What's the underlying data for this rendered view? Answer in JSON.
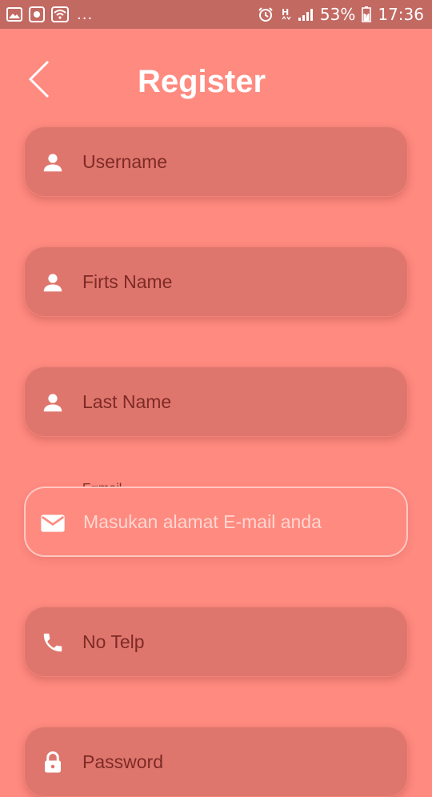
{
  "status_bar": {
    "left_icons": [
      "image-icon",
      "screenshot-icon",
      "wifi-icon"
    ],
    "overflow": "...",
    "right_icons": [
      "alarm-icon",
      "h-plus-icon",
      "signal-icon"
    ],
    "battery_percent": "53%",
    "time": "17:36"
  },
  "header": {
    "back_icon": "chevron-left-icon",
    "title": "Register"
  },
  "form": {
    "fields": [
      {
        "icon": "person-icon",
        "placeholder": "Username"
      },
      {
        "icon": "person-icon",
        "placeholder": "Firts Name"
      },
      {
        "icon": "person-icon",
        "placeholder": "Last Name"
      },
      {
        "icon": "mail-icon",
        "label": "E=mail",
        "placeholder": "Masukan alamat E-mail anda"
      },
      {
        "icon": "phone-icon",
        "placeholder": "No Telp"
      },
      {
        "icon": "lock-icon",
        "placeholder": "Password"
      }
    ]
  },
  "colors": {
    "background": "#ff8a80",
    "status_bar": "#c26962",
    "field_fill": "#df766d",
    "field_text": "#7d2b25",
    "title": "#ffffff"
  }
}
